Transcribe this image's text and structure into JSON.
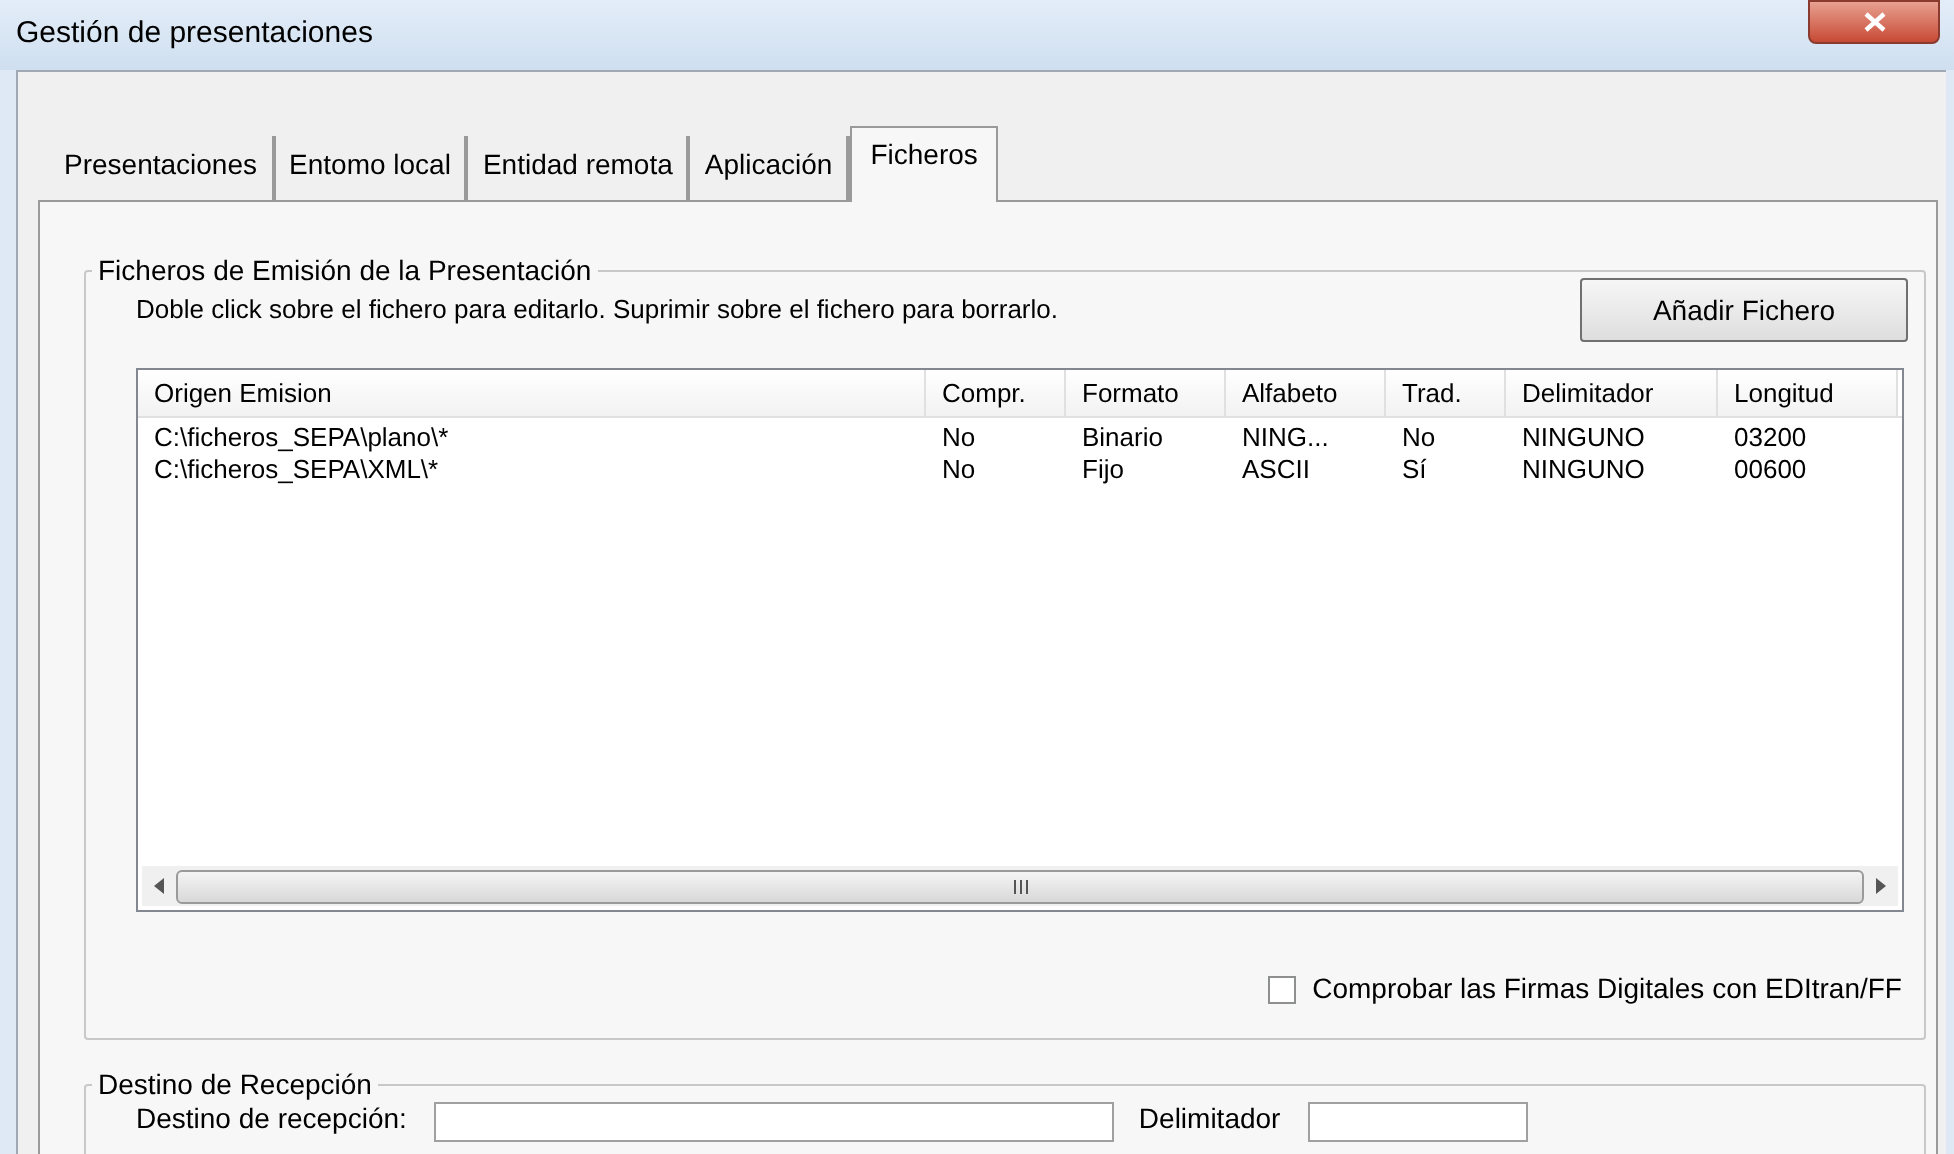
{
  "window": {
    "title": "Gestión de presentaciones"
  },
  "tabs": [
    {
      "label": "Presentaciones",
      "selected": false
    },
    {
      "label": "Entomo local",
      "selected": false
    },
    {
      "label": "Entidad remota",
      "selected": false
    },
    {
      "label": "Aplicación",
      "selected": false
    },
    {
      "label": "Ficheros",
      "selected": true
    }
  ],
  "emission_group": {
    "title": "Ficheros de Emisión de la Presentación",
    "hint": "Doble click sobre el fichero para editarlo. Suprimir sobre el fichero para borrarlo.",
    "add_button": "Añadir Fichero",
    "table": {
      "columns": [
        "Origen Emision",
        "Compr.",
        "Formato",
        "Alfabeto",
        "Trad.",
        "Delimitador",
        "Longitud"
      ],
      "rows": [
        [
          "C:\\ficheros_SEPA\\plano\\*",
          "No",
          "Binario",
          "NING...",
          "No",
          "NINGUNO",
          "03200"
        ],
        [
          "C:\\ficheros_SEPA\\XML\\*",
          "No",
          "Fijo",
          "ASCII",
          "Sí",
          "NINGUNO",
          "00600"
        ]
      ]
    },
    "verify_checkbox": {
      "label": "Comprobar las Firmas Digitales con EDItran/FF",
      "checked": false
    }
  },
  "reception_group": {
    "title": "Destino de Recepción",
    "fields": [
      {
        "label": "Destino de recepción:"
      },
      {
        "label": "Delimitador"
      }
    ]
  }
}
